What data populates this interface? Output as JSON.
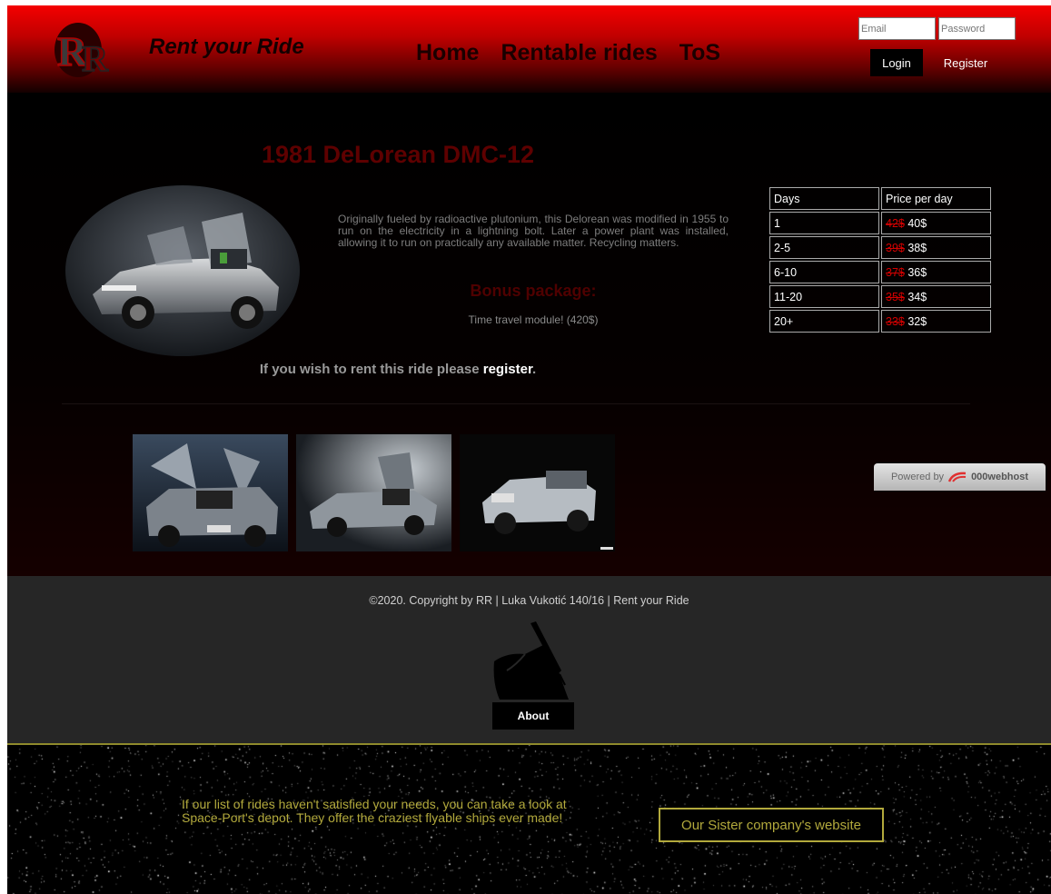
{
  "header": {
    "logo_text": "RR",
    "brand": "Rent your Ride",
    "nav": [
      "Home",
      "Rentable rides",
      "ToS"
    ],
    "email_placeholder": "Email",
    "password_placeholder": "Password",
    "login_label": "Login",
    "register_label": "Register"
  },
  "product": {
    "title": "1981 DeLorean DMC-12",
    "description": "Originally fueled by radioactive plutonium, this Delorean was modified in 1955 to run on the electricity in a lightning bolt. Later a power plant was installed, allowing it to run on practically any available matter. Recycling matters.",
    "bonus_title": "Bonus package:",
    "bonus_text": "Time travel module! (420$)",
    "cta_prefix": "If you wish to rent this ride please ",
    "cta_link": "register",
    "cta_suffix": "."
  },
  "price_table": {
    "headers": [
      "Days",
      "Price per day"
    ],
    "rows": [
      {
        "days": "1",
        "old": "42$",
        "new": " 40$"
      },
      {
        "days": "2-5",
        "old": "39$",
        "new": " 38$"
      },
      {
        "days": "6-10",
        "old": "37$",
        "new": " 36$"
      },
      {
        "days": "11-20",
        "old": "35$",
        "new": " 34$"
      },
      {
        "days": "20+",
        "old": "33$",
        "new": " 32$"
      }
    ]
  },
  "powered_by": {
    "prefix": "Powered by",
    "brand": "000webhost"
  },
  "footer": {
    "copyright": "©2020. Copyright by RR | Luka Vukotić 140/16 | Rent your Ride",
    "about_label": "About"
  },
  "sister": {
    "text": "If our list of rides haven't satisfied your needs, you can take a look at Space-Port's depot. They offer the craziest flyable ships ever made!",
    "button_label": "Our Sister company's website"
  },
  "colors": {
    "header_red": "#f40000",
    "title_red": "#5e0000",
    "gold": "#b2a93c",
    "footer_gray": "#262626"
  }
}
